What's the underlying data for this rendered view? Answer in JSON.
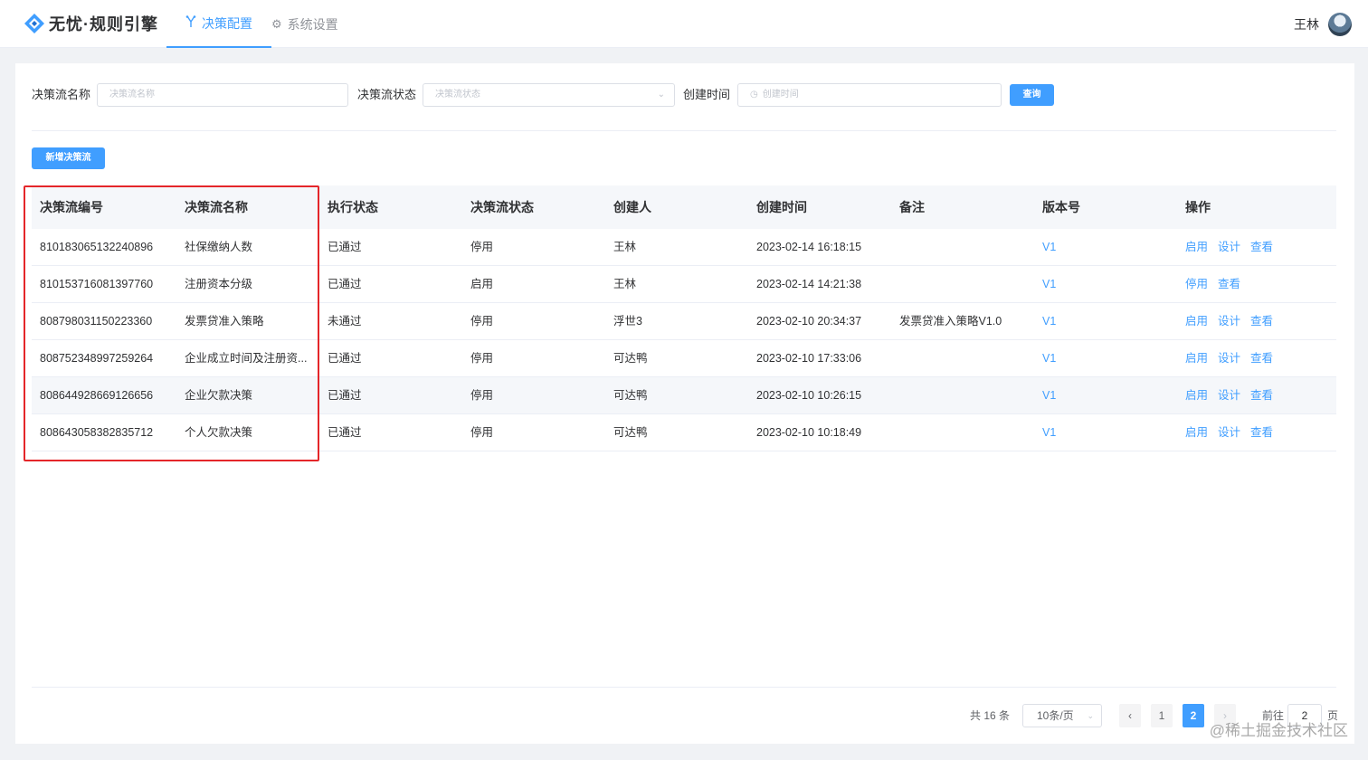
{
  "app": {
    "title": "无忧·规则引擎"
  },
  "nav": {
    "tabs": [
      {
        "label": "决策配置",
        "icon": "flow-branch-icon",
        "active": true
      },
      {
        "label": "系统设置",
        "icon": "gear-icon",
        "active": false
      }
    ]
  },
  "user": {
    "name": "王林"
  },
  "filters": {
    "name_label": "决策流名称",
    "name_placeholder": "决策流名称",
    "status_label": "决策流状态",
    "status_placeholder": "决策流状态",
    "time_label": "创建时间",
    "time_placeholder": "创建时间",
    "query_button": "查询"
  },
  "toolbar": {
    "add_button": "新增决策流"
  },
  "table": {
    "headers": [
      "决策流编号",
      "决策流名称",
      "执行状态",
      "决策流状态",
      "创建人",
      "创建时间",
      "备注",
      "版本号",
      "操作"
    ],
    "rows": [
      {
        "id": "810183065132240896",
        "name": "社保缴纳人数",
        "exec_status": "已通过",
        "flow_status": "停用",
        "creator": "王林",
        "created": "2023-02-14 16:18:15",
        "remark": "",
        "version": "V1",
        "ops": [
          "启用",
          "设计",
          "查看"
        ]
      },
      {
        "id": "810153716081397760",
        "name": "注册资本分级",
        "exec_status": "已通过",
        "flow_status": "启用",
        "creator": "王林",
        "created": "2023-02-14 14:21:38",
        "remark": "",
        "version": "V1",
        "ops": [
          "停用",
          "查看",
          ""
        ]
      },
      {
        "id": "808798031150223360",
        "name": "发票贷准入策略",
        "exec_status": "未通过",
        "flow_status": "停用",
        "creator": "浮世3",
        "created": "2023-02-10 20:34:37",
        "remark": "发票贷准入策略V1.0",
        "version": "V1",
        "ops": [
          "启用",
          "设计",
          "查看"
        ]
      },
      {
        "id": "808752348997259264",
        "name": "企业成立时间及注册资...",
        "exec_status": "已通过",
        "flow_status": "停用",
        "creator": "可达鸭",
        "created": "2023-02-10 17:33:06",
        "remark": "",
        "version": "V1",
        "ops": [
          "启用",
          "设计",
          "查看"
        ]
      },
      {
        "id": "808644928669126656",
        "name": "企业欠款决策",
        "exec_status": "已通过",
        "flow_status": "停用",
        "creator": "可达鸭",
        "created": "2023-02-10 10:26:15",
        "remark": "",
        "version": "V1",
        "ops": [
          "启用",
          "设计",
          "查看"
        ]
      },
      {
        "id": "808643058382835712",
        "name": "个人欠款决策",
        "exec_status": "已通过",
        "flow_status": "停用",
        "creator": "可达鸭",
        "created": "2023-02-10 10:18:49",
        "remark": "",
        "version": "V1",
        "ops": [
          "启用",
          "设计",
          "查看"
        ]
      }
    ]
  },
  "pagination": {
    "total": "共 16 条",
    "page_size": "10条/页",
    "prev": "‹",
    "pages": [
      "1",
      "2"
    ],
    "current": "2",
    "next": "›",
    "goto_label": "前往",
    "goto_value": "2",
    "page_suffix": "页"
  },
  "watermark": "@稀土掘金技术社区",
  "colors": {
    "primary": "#409eff",
    "highlight_box": "#e4262a"
  }
}
